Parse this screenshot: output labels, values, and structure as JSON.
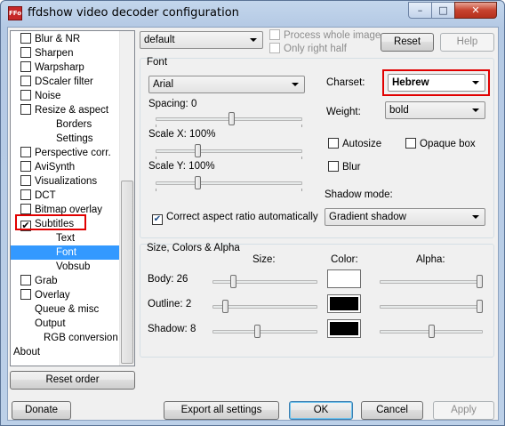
{
  "window": {
    "title": "ffdshow video decoder configuration",
    "icon_text": "FFo",
    "min": "–",
    "max": "□",
    "close": "✕"
  },
  "tree": {
    "items": [
      {
        "label": "Blur & NR",
        "checkbox": true,
        "checked": false,
        "indent": 0
      },
      {
        "label": "Sharpen",
        "checkbox": true,
        "checked": false,
        "indent": 0
      },
      {
        "label": "Warpsharp",
        "checkbox": true,
        "checked": false,
        "indent": 0
      },
      {
        "label": "DScaler filter",
        "checkbox": true,
        "checked": false,
        "indent": 0
      },
      {
        "label": "Noise",
        "checkbox": true,
        "checked": false,
        "indent": 0
      },
      {
        "label": "Resize & aspect",
        "checkbox": true,
        "checked": false,
        "indent": 0
      },
      {
        "label": "Borders",
        "checkbox": false,
        "indent": 2
      },
      {
        "label": "Settings",
        "checkbox": false,
        "indent": 2
      },
      {
        "label": "Perspective corr.",
        "checkbox": true,
        "checked": false,
        "indent": 0
      },
      {
        "label": "AviSynth",
        "checkbox": true,
        "checked": false,
        "indent": 0
      },
      {
        "label": "Visualizations",
        "checkbox": true,
        "checked": false,
        "indent": 0
      },
      {
        "label": "DCT",
        "checkbox": true,
        "checked": false,
        "indent": 0
      },
      {
        "label": "Bitmap overlay",
        "checkbox": true,
        "checked": false,
        "indent": 0
      },
      {
        "label": "Subtitles",
        "checkbox": true,
        "checked": true,
        "indent": 0
      },
      {
        "label": "Text",
        "checkbox": false,
        "indent": 2
      },
      {
        "label": "Font",
        "checkbox": false,
        "indent": 2,
        "selected": true
      },
      {
        "label": "Vobsub",
        "checkbox": false,
        "indent": 2
      },
      {
        "label": "Grab",
        "checkbox": true,
        "checked": false,
        "indent": 0
      },
      {
        "label": "Overlay",
        "checkbox": true,
        "checked": false,
        "indent": 0
      },
      {
        "label": "Queue & misc",
        "checkbox": false,
        "indent": 1
      },
      {
        "label": "Output",
        "checkbox": false,
        "indent": 1
      },
      {
        "label": "RGB conversion",
        "checkbox": false,
        "indent": 3
      },
      {
        "label": "About",
        "checkbox": false,
        "indent": -1
      }
    ],
    "check_mark": "✔"
  },
  "top": {
    "preset": "default",
    "process_whole_image": "Process whole image",
    "only_right_half": "Only right half",
    "reset": "Reset",
    "help": "Help"
  },
  "font_group": {
    "title": "Font",
    "font_name": "Arial",
    "spacing_label": "Spacing: 0",
    "scale_x_label": "Scale X: 100%",
    "scale_y_label": "Scale Y: 100%",
    "correct_aspect": "Correct aspect ratio automatically",
    "correct_aspect_checked": true,
    "charset_label": "Charset:",
    "charset_value": "Hebrew",
    "weight_label": "Weight:",
    "weight_value": "bold",
    "autosize": "Autosize",
    "opaque_box": "Opaque box",
    "blur": "Blur",
    "shadow_mode_label": "Shadow mode:",
    "shadow_mode_value": "Gradient shadow"
  },
  "colors_group": {
    "title": "Size, Colors & Alpha",
    "size_header": "Size:",
    "color_header": "Color:",
    "alpha_header": "Alpha:",
    "rows": [
      {
        "label": "Body: 26",
        "color": "#ffffff"
      },
      {
        "label": "Outline: 2",
        "color": "#000000"
      },
      {
        "label": "Shadow: 8",
        "color": "#000000"
      }
    ]
  },
  "bottom": {
    "reset_order": "Reset order",
    "donate": "Donate",
    "export": "Export all settings",
    "ok": "OK",
    "cancel": "Cancel",
    "apply": "Apply"
  }
}
